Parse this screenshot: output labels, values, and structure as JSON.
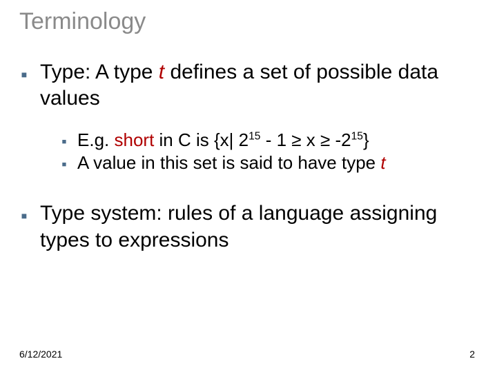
{
  "title": "Terminology",
  "b1": {
    "pre": "Type: A type ",
    "t": "t",
    "post": " defines a set of possible data values"
  },
  "b1a": {
    "pre": "E.g. ",
    "short": "short",
    "mid1": "  in C is {x| 2",
    "exp1": "15",
    "mid2": " - 1 ≥ x ≥ -2",
    "exp2": "15",
    "post": "}"
  },
  "b1b": {
    "pre": " A value in this set is said to have type ",
    "t": "t"
  },
  "b2": "Type system: rules of a language assigning types to expressions",
  "footer": {
    "date": "6/12/2021",
    "page": "2"
  }
}
